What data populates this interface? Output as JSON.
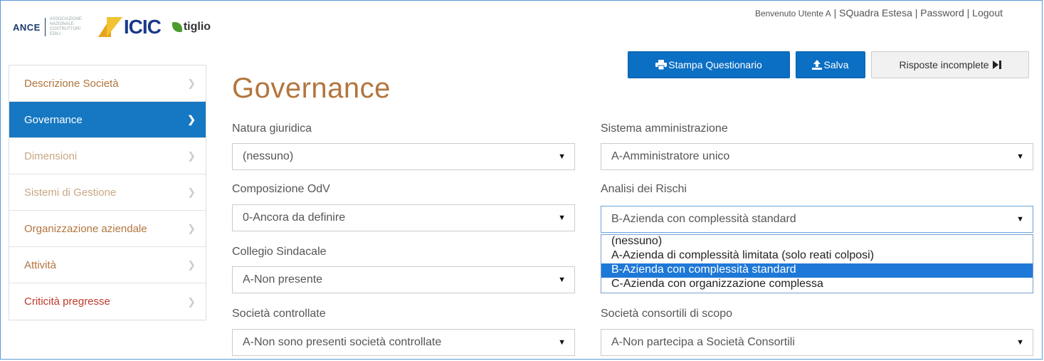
{
  "header": {
    "ance_text": "ANCE",
    "ance_sub": "ASSOCIAZIONE NAZIONALE COSTRUTTORI EDILI",
    "icic_text": "ICIC",
    "tiglio_text": "tiglio",
    "welcome": "Benvenuto Utente A",
    "separator": "|",
    "squadra": "SQuadra Estesa",
    "password": "Password",
    "logout": "Logout"
  },
  "toolbar": {
    "stampa_label": "Stampa Questionario",
    "salva_label": "Salva",
    "risposte_label": "Risposte incomplete"
  },
  "sidebar": {
    "items": [
      {
        "label": "Descrizione Società"
      },
      {
        "label": "Governance"
      },
      {
        "label": "Dimensioni"
      },
      {
        "label": "Sistemi di Gestione"
      },
      {
        "label": "Organizzazione aziendale"
      },
      {
        "label": "Attività"
      },
      {
        "label": "Criticità pregresse"
      }
    ]
  },
  "main": {
    "title": "Governance",
    "fields": {
      "natura": {
        "label": "Natura giuridica",
        "value": "(nessuno)"
      },
      "sistema": {
        "label": "Sistema amministrazione",
        "value": "A-Amministratore unico"
      },
      "composizione": {
        "label": "Composizione OdV",
        "value": "0-Ancora da definire"
      },
      "analisi": {
        "label": "Analisi dei Rischi",
        "value": "B-Azienda con complessità standard"
      },
      "collegio": {
        "label": "Collegio Sindacale",
        "value": "A-Non presente"
      },
      "controllate": {
        "label": "Società controllate",
        "value": "A-Non sono presenti società controllate"
      },
      "consortili": {
        "label": "Società consortili di scopo",
        "value": "A-Non partecipa a Società Consortili"
      }
    },
    "analisi_options": [
      "(nessuno)",
      "A-Azienda di complessità limitata (solo reati colposi)",
      "B-Azienda con complessità standard",
      "C-Azienda con organizzazione complessa"
    ],
    "analisi_selected_index": 2
  },
  "colors": {
    "primary": "#0b6fc4",
    "sidebar_active": "#1678c2",
    "title": "#b3753d",
    "option_highlight": "#1e78d7"
  }
}
